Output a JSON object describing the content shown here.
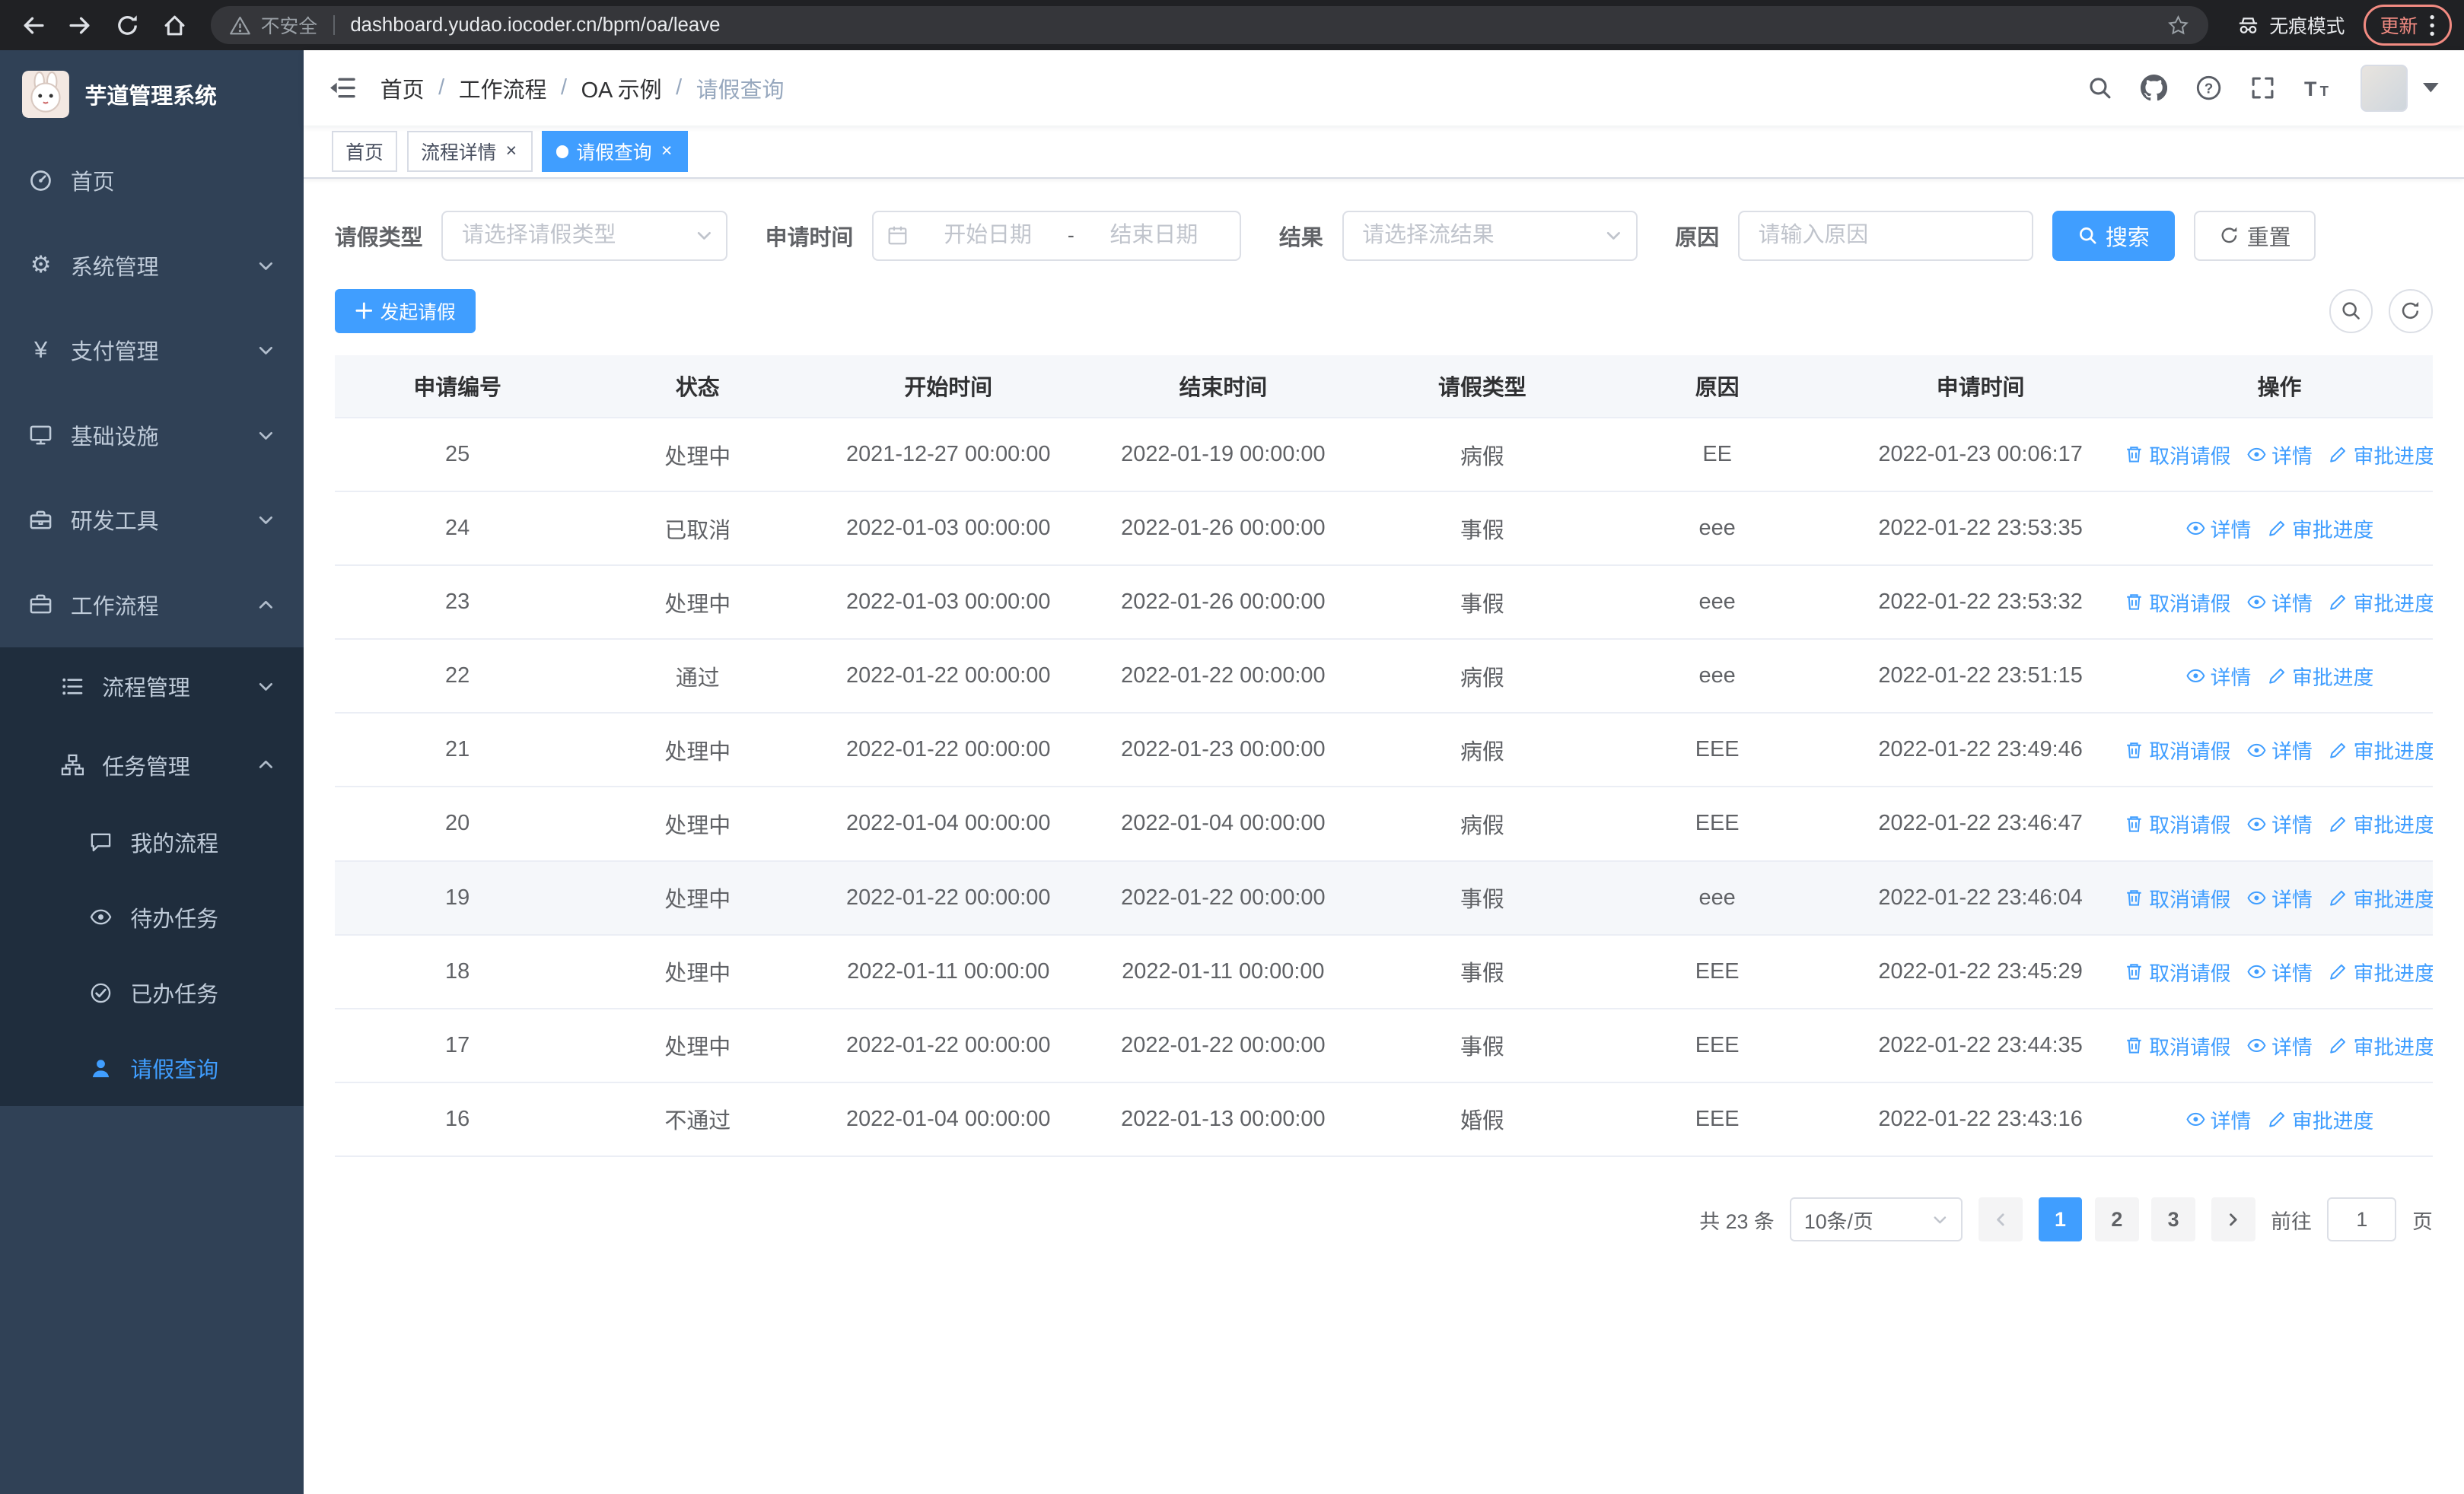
{
  "colors": {
    "primary": "#409eff",
    "sidebar_bg": "#304156",
    "submenu_bg": "#1f2d3d",
    "sidebar_text": "#bfcbd9"
  },
  "browser": {
    "security_label": "不安全",
    "url": "dashboard.yudao.iocoder.cn/bpm/oa/leave",
    "incognito_label": "无痕模式",
    "update_label": "更新"
  },
  "sidebar": {
    "app_title": "芋道管理系统",
    "menu": [
      {
        "name": "home",
        "label": "首页",
        "icon": "home-icon",
        "arrow": "none",
        "level": 1,
        "active": false
      },
      {
        "name": "system-management",
        "label": "系统管理",
        "icon": "gear-icon",
        "arrow": "down",
        "level": 1,
        "active": false
      },
      {
        "name": "payment-management",
        "label": "支付管理",
        "icon": "yen-icon",
        "arrow": "down",
        "level": 1,
        "active": false
      },
      {
        "name": "infrastructure",
        "label": "基础设施",
        "icon": "monitor-icon",
        "arrow": "down",
        "level": 1,
        "active": false
      },
      {
        "name": "dev-tools",
        "label": "研发工具",
        "icon": "toolbox-icon",
        "arrow": "down",
        "level": 1,
        "active": false
      },
      {
        "name": "workflow",
        "label": "工作流程",
        "icon": "briefcase-icon",
        "arrow": "up",
        "level": 1,
        "active": false
      },
      {
        "name": "process-management",
        "label": "流程管理",
        "icon": "list-icon",
        "arrow": "down",
        "level": 2,
        "active": false
      },
      {
        "name": "task-management",
        "label": "任务管理",
        "icon": "org-icon",
        "arrow": "up",
        "level": 2,
        "active": false
      },
      {
        "name": "my-processes",
        "label": "我的流程",
        "icon": "chat-icon",
        "arrow": "none",
        "level": 3,
        "active": false
      },
      {
        "name": "todo-tasks",
        "label": "待办任务",
        "icon": "eye-icon",
        "arrow": "none",
        "level": 3,
        "active": false
      },
      {
        "name": "done-tasks",
        "label": "已办任务",
        "icon": "done-icon",
        "arrow": "none",
        "level": 3,
        "active": false
      },
      {
        "name": "leave-query",
        "label": "请假查询",
        "icon": "user-icon",
        "arrow": "none",
        "level": 3,
        "active": true
      }
    ]
  },
  "header": {
    "breadcrumb": [
      "首页",
      "工作流程",
      "OA 示例",
      "请假查询"
    ]
  },
  "tabs": [
    {
      "name": "home",
      "label": "首页",
      "closable": false,
      "active": false
    },
    {
      "name": "process-detail",
      "label": "流程详情",
      "closable": true,
      "active": false
    },
    {
      "name": "leave-query",
      "label": "请假查询",
      "closable": true,
      "active": true
    }
  ],
  "filters": {
    "leave_type_label": "请假类型",
    "leave_type_placeholder": "请选择请假类型",
    "apply_time_label": "申请时间",
    "start_date_placeholder": "开始日期",
    "range_separator": "-",
    "end_date_placeholder": "结束日期",
    "result_label": "结果",
    "result_placeholder": "请选择流结果",
    "reason_label": "原因",
    "reason_placeholder": "请输入原因",
    "search_label": "搜索",
    "reset_label": "重置"
  },
  "toolbar": {
    "create_label": "发起请假"
  },
  "table": {
    "columns": [
      "申请编号",
      "状态",
      "开始时间",
      "结束时间",
      "请假类型",
      "原因",
      "申请时间",
      "操作"
    ],
    "action_labels": {
      "cancel": "取消请假",
      "detail": "详情",
      "progress": "审批进度"
    },
    "rows": [
      {
        "id": "25",
        "status": "处理中",
        "start": "2021-12-27 00:00:00",
        "end": "2022-01-19 00:00:00",
        "type": "病假",
        "reason": "EE",
        "applied": "2022-01-23 00:06:17",
        "actions": [
          "cancel",
          "detail",
          "progress"
        ],
        "hovered": false
      },
      {
        "id": "24",
        "status": "已取消",
        "start": "2022-01-03 00:00:00",
        "end": "2022-01-26 00:00:00",
        "type": "事假",
        "reason": "eee",
        "applied": "2022-01-22 23:53:35",
        "actions": [
          "detail",
          "progress"
        ],
        "hovered": false
      },
      {
        "id": "23",
        "status": "处理中",
        "start": "2022-01-03 00:00:00",
        "end": "2022-01-26 00:00:00",
        "type": "事假",
        "reason": "eee",
        "applied": "2022-01-22 23:53:32",
        "actions": [
          "cancel",
          "detail",
          "progress"
        ],
        "hovered": false
      },
      {
        "id": "22",
        "status": "通过",
        "start": "2022-01-22 00:00:00",
        "end": "2022-01-22 00:00:00",
        "type": "病假",
        "reason": "eee",
        "applied": "2022-01-22 23:51:15",
        "actions": [
          "detail",
          "progress"
        ],
        "hovered": false
      },
      {
        "id": "21",
        "status": "处理中",
        "start": "2022-01-22 00:00:00",
        "end": "2022-01-23 00:00:00",
        "type": "病假",
        "reason": "EEE",
        "applied": "2022-01-22 23:49:46",
        "actions": [
          "cancel",
          "detail",
          "progress"
        ],
        "hovered": false
      },
      {
        "id": "20",
        "status": "处理中",
        "start": "2022-01-04 00:00:00",
        "end": "2022-01-04 00:00:00",
        "type": "病假",
        "reason": "EEE",
        "applied": "2022-01-22 23:46:47",
        "actions": [
          "cancel",
          "detail",
          "progress"
        ],
        "hovered": false
      },
      {
        "id": "19",
        "status": "处理中",
        "start": "2022-01-22 00:00:00",
        "end": "2022-01-22 00:00:00",
        "type": "事假",
        "reason": "eee",
        "applied": "2022-01-22 23:46:04",
        "actions": [
          "cancel",
          "detail",
          "progress"
        ],
        "hovered": true
      },
      {
        "id": "18",
        "status": "处理中",
        "start": "2022-01-11 00:00:00",
        "end": "2022-01-11 00:00:00",
        "type": "事假",
        "reason": "EEE",
        "applied": "2022-01-22 23:45:29",
        "actions": [
          "cancel",
          "detail",
          "progress"
        ],
        "hovered": false
      },
      {
        "id": "17",
        "status": "处理中",
        "start": "2022-01-22 00:00:00",
        "end": "2022-01-22 00:00:00",
        "type": "事假",
        "reason": "EEE",
        "applied": "2022-01-22 23:44:35",
        "actions": [
          "cancel",
          "detail",
          "progress"
        ],
        "hovered": false
      },
      {
        "id": "16",
        "status": "不通过",
        "start": "2022-01-04 00:00:00",
        "end": "2022-01-13 00:00:00",
        "type": "婚假",
        "reason": "EEE",
        "applied": "2022-01-22 23:43:16",
        "actions": [
          "detail",
          "progress"
        ],
        "hovered": false
      }
    ]
  },
  "pagination": {
    "total_label": "共 23 条",
    "page_size_label": "10条/页",
    "pages": [
      "1",
      "2",
      "3"
    ],
    "current": "1",
    "goto_label": "前往",
    "goto_value": "1",
    "page_unit_label": "页"
  }
}
